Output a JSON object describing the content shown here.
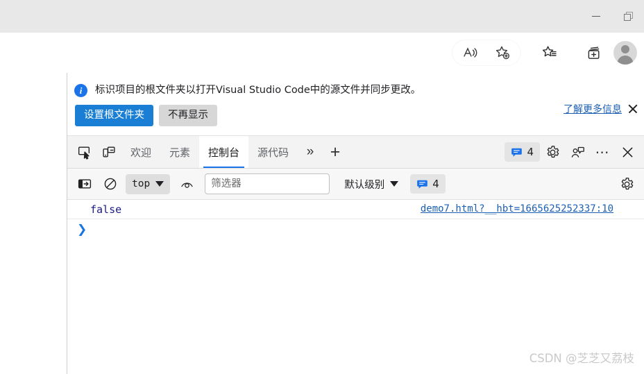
{
  "window": {
    "minimize_label": "Minimize",
    "restore_label": "Restore"
  },
  "browser_toolbar": {
    "read_aloud_label": "Read aloud",
    "add_favorite_label": "Add this page to favorites",
    "favorites_label": "Favorites",
    "collections_label": "Collections",
    "profile_label": "Profile"
  },
  "devtools": {
    "infobar": {
      "message": "标识项目的根文件夹以打开Visual Studio Code中的源文件并同步更改。",
      "info_glyph": "i",
      "primary_button": "设置根文件夹",
      "secondary_button": "不再显示",
      "learn_more": "了解更多信息",
      "close_label": "关闭"
    },
    "tabbar": {
      "inspect_label": "检查",
      "device_toolbar_label": "设备工具栏",
      "tabs": [
        {
          "label": "欢迎",
          "active": false
        },
        {
          "label": "元素",
          "active": false
        },
        {
          "label": "控制台",
          "active": true
        },
        {
          "label": "源代码",
          "active": false
        }
      ],
      "more_tabs_glyph": "»",
      "add_tab_glyph": "+",
      "message_count": "4",
      "settings_label": "设置",
      "customize_label": "自定义",
      "more_options_glyph": "⋯",
      "close_label": "关闭开发人员工具"
    },
    "console_toolbar": {
      "sidebar_toggle_label": "控制台边栏",
      "clear_console_label": "清除控制台",
      "context": "top",
      "live_expression_label": "创建实时表达式",
      "filter_placeholder": "筛选器",
      "filter_value": "",
      "level": "默认级别",
      "message_count": "4",
      "settings_label": "控制台设置"
    },
    "console_messages": [
      {
        "value": "false",
        "source": "demo7.html?__hbt=1665625252337:10"
      }
    ],
    "prompt_glyph": "❯"
  },
  "watermark": "CSDN @芝芝又荔枝",
  "colors": {
    "accent": "#1a73e8",
    "primary_button": "#1a7fd4",
    "link": "#1a5fb4",
    "console_value": "#1a1a8c",
    "titlebar": "#e8e8e8"
  }
}
